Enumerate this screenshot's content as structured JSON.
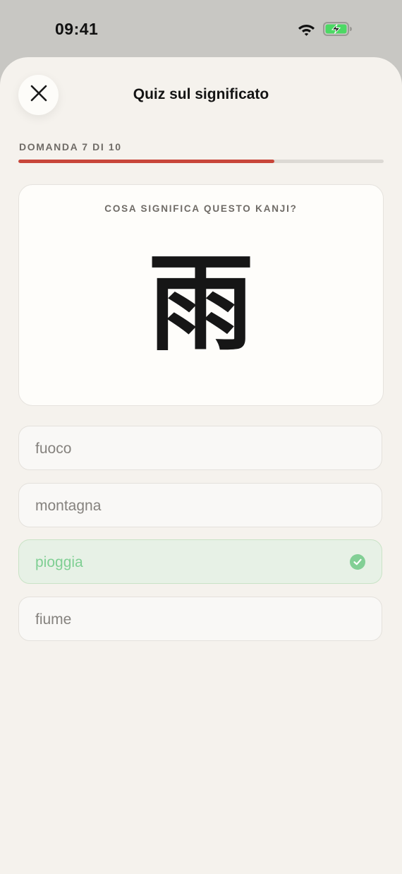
{
  "status": {
    "time": "09:41",
    "wifi_icon": "wifi-icon",
    "battery_icon": "battery-charging-icon",
    "battery_color": "#4cd964"
  },
  "header": {
    "title": "Quiz sul significato",
    "close_icon": "close-icon"
  },
  "progress": {
    "label": "DOMANDA 7 DI 10",
    "current": 7,
    "total": 10,
    "fraction": 0.7,
    "color": "#c8463a"
  },
  "question": {
    "prompt": "COSA SIGNIFICA QUESTO KANJI?",
    "kanji": "雨"
  },
  "options": [
    {
      "label": "fuoco",
      "state": "default"
    },
    {
      "label": "montagna",
      "state": "default"
    },
    {
      "label": "pioggia",
      "state": "correct",
      "icon": "checkmark-circle-icon",
      "color": "#82cf95"
    },
    {
      "label": "fiume",
      "state": "default"
    }
  ]
}
